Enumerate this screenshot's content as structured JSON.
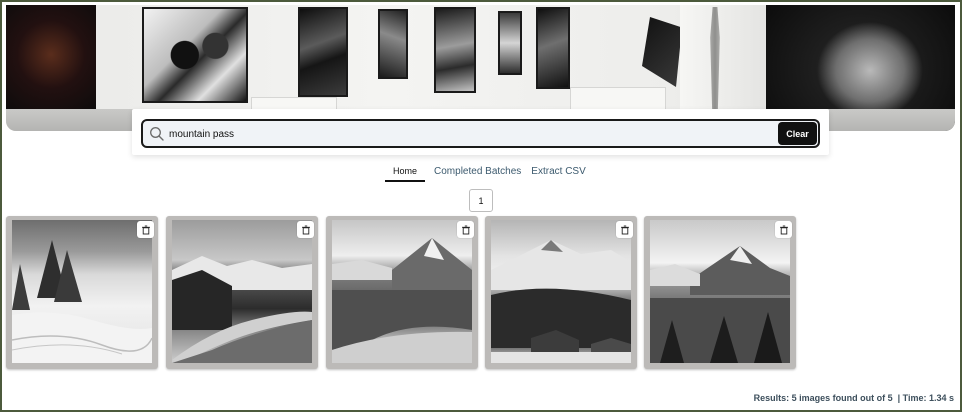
{
  "search": {
    "value": "mountain pass",
    "clear_label": "Clear"
  },
  "nav": {
    "tabs": [
      {
        "label": "Home",
        "active": true
      },
      {
        "label": "Completed Batches",
        "active": false
      },
      {
        "label": "Extract CSV",
        "active": false
      }
    ]
  },
  "pagination": {
    "current_page": "1"
  },
  "results": {
    "images": [
      {
        "subject": "snowy pine trees and ski tracks"
      },
      {
        "subject": "winding road through mountain pass"
      },
      {
        "subject": "valley and mountain peak"
      },
      {
        "subject": "snow-covered slopes with chalets"
      },
      {
        "subject": "mountain peak above forest"
      }
    ],
    "status_text": "Results: 5 images found out of 5  | Time: 1.34 s"
  },
  "icons": {
    "search": "search-icon",
    "delete": "trash-icon"
  },
  "colors": {
    "frame_border": "#4c5a3c",
    "clear_button": "#111111",
    "tab_text": "#3c5a6e",
    "status_text": "#3d4f5c"
  }
}
